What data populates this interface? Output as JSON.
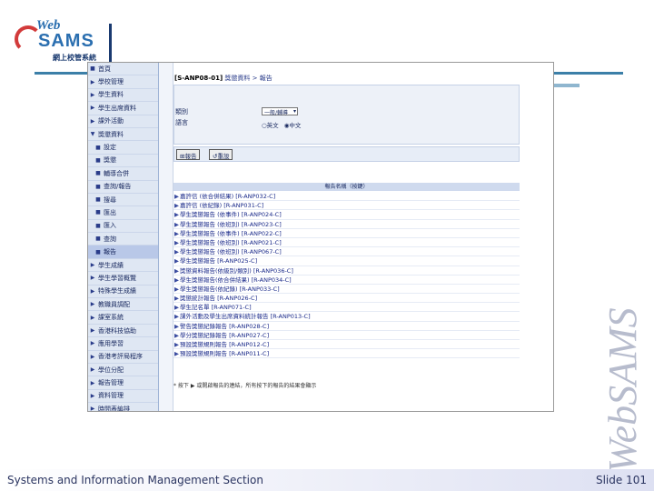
{
  "logo": {
    "web": "Web",
    "sams": "SAMS",
    "subtitle": "網上校管系統"
  },
  "sidebar": {
    "items": [
      {
        "label": "首頁",
        "mark": "■",
        "sub": false,
        "active": false
      },
      {
        "label": "學校管理",
        "mark": "▶",
        "sub": false,
        "active": false
      },
      {
        "label": "學生資料",
        "mark": "▶",
        "sub": false,
        "active": false
      },
      {
        "label": "學生出席資料",
        "mark": "▶",
        "sub": false,
        "active": false
      },
      {
        "label": "課外活動",
        "mark": "▶",
        "sub": false,
        "active": false
      },
      {
        "label": "獎懲資料",
        "mark": "▼",
        "sub": false,
        "active": false
      },
      {
        "label": "設定",
        "mark": "■",
        "sub": true,
        "active": false
      },
      {
        "label": "獎懲",
        "mark": "■",
        "sub": true,
        "active": false
      },
      {
        "label": "輔導合併",
        "mark": "■",
        "sub": true,
        "active": false
      },
      {
        "label": "查詢/報告",
        "mark": "■",
        "sub": true,
        "active": false
      },
      {
        "label": "搜尋",
        "mark": "■",
        "sub": true,
        "active": false
      },
      {
        "label": "匯出",
        "mark": "■",
        "sub": true,
        "active": false
      },
      {
        "label": "匯入",
        "mark": "■",
        "sub": true,
        "active": false
      },
      {
        "label": "查詢",
        "mark": "■",
        "sub": true,
        "active": false
      },
      {
        "label": "報告",
        "mark": "■",
        "sub": true,
        "active": true
      },
      {
        "label": "學生成績",
        "mark": "▶",
        "sub": false,
        "active": false
      },
      {
        "label": "學生學習概覽",
        "mark": "▶",
        "sub": false,
        "active": false
      },
      {
        "label": "特殊學生成績",
        "mark": "▶",
        "sub": false,
        "active": false
      },
      {
        "label": "教職員調配",
        "mark": "▶",
        "sub": false,
        "active": false
      },
      {
        "label": "課室系統",
        "mark": "▶",
        "sub": false,
        "active": false
      },
      {
        "label": "香港科技協助",
        "mark": "▶",
        "sub": false,
        "active": false
      },
      {
        "label": "應用學習",
        "mark": "▶",
        "sub": false,
        "active": false
      },
      {
        "label": "香港考評局程序",
        "mark": "▶",
        "sub": false,
        "active": false
      },
      {
        "label": "學位分配",
        "mark": "▶",
        "sub": false,
        "active": false
      },
      {
        "label": "報告管理",
        "mark": "▶",
        "sub": false,
        "active": false
      },
      {
        "label": "資料管理",
        "mark": "▶",
        "sub": false,
        "active": false
      },
      {
        "label": "時間表編排",
        "mark": "▶",
        "sub": false,
        "active": false
      }
    ]
  },
  "breadcrumb": {
    "code": "[S-ANP08-01]",
    "path": "獎懲資料 > 報告"
  },
  "form": {
    "type_label": "類別",
    "type_value": "一般/輔導",
    "lang_label": "語言",
    "lang_en": "英文",
    "lang_zh": "中文",
    "lang_selected": "中文"
  },
  "buttons": {
    "generate": "報告",
    "reset": "重設"
  },
  "reports_header": "報告名稱（按鍵）",
  "reports": [
    "嘉許信 (依合併結果) [R-ANP032-C]",
    "嘉許信 (依紀錄) [R-ANP031-C]",
    "學生獎懲報告 (依事件) [R-ANP024-C]",
    "學生獎懲報告 (依班別) [R-ANP023-C]",
    "學生獎懲報告 (依事件) [R-ANP022-C]",
    "學生獎懲報告 (依班別) [R-ANP021-C]",
    "學生獎懲報告 (依班別) [R-ANP067-C]",
    "學生獎懲報告 [R-ANP025-C]",
    "獎懲資料報告(依級別/類別) [R-ANP036-C]",
    "學生獎懲報告(依合併結果) [R-ANP034-C]",
    "學生獎懲報告(依紀錄) [R-ANP033-C]",
    "獎懲統計報告 [R-ANP026-C]",
    "學生記名單 [R-ANP071-C]",
    "課外活動及學生出席資料統計報告 [R-ANP013-C]",
    "警告獎懲紀錄報告 [R-ANP028-C]",
    "學分獎懲紀錄報告 [R-ANP027-C]",
    "預設獎懲規則報告 [R-ANP012-C]",
    "預設獎懲規則報告 [R-ANP011-C]"
  ],
  "footnote": "* 按下 ▶ 或開啟報告的連結，所有按下的報告的結果會顯示",
  "watermark": "WebSAMS",
  "footer": {
    "left": "Systems and Information Management Section",
    "right": "Slide 101"
  }
}
